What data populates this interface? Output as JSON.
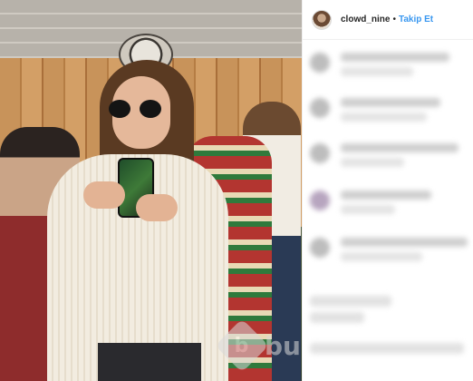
{
  "post": {
    "username": "clowd_nine",
    "separator": "•",
    "follow_label": "Takip Et"
  },
  "watermark": {
    "logo_letter": "b",
    "text": "bu"
  },
  "colors": {
    "follow": "#3897f0",
    "username": "#262626",
    "divider": "#efefef"
  },
  "comments_visible": false
}
